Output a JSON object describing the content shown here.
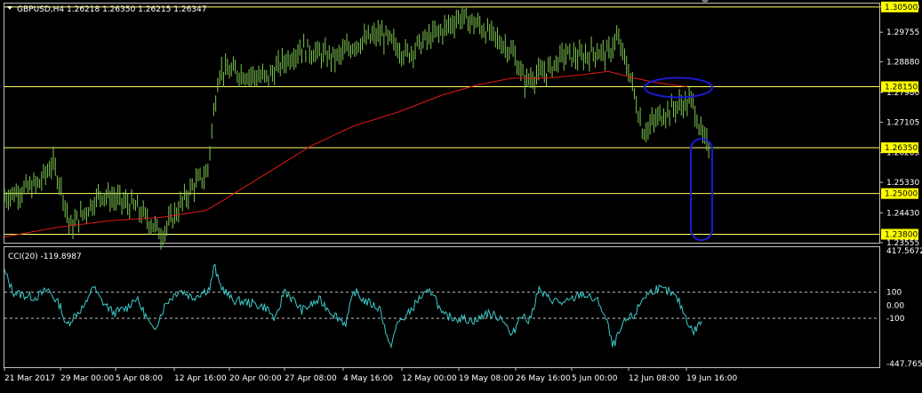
{
  "header": {
    "menu_icon": "triangle-down-icon",
    "title": "GBPUSD,H4  1.26218 1.26350 1.26215 1.26347"
  },
  "colors": {
    "background": "#000000",
    "frame": "#c0c0c0",
    "candles": "#7ec850",
    "moving_average": "#e01818",
    "level_line": "#ffff66",
    "level_label_bg": "#ffff00",
    "cci_line": "#3cc8c8",
    "annotation": "#1a1ad0",
    "text": "#ffffff"
  },
  "chart_data": [
    {
      "type": "line",
      "title": "GBPUSD,H4  1.26218 1.26350 1.26215 1.26347",
      "ylim": [
        1.2355,
        1.306
      ],
      "price_ticks": [
        "1.30500",
        "1.29755",
        "1.28880",
        "1.27980",
        "1.27105",
        "1.26205",
        "1.25330",
        "1.24430",
        "1.23555"
      ],
      "horizontal_levels": [
        "1.30500",
        "1.28150",
        "1.26350",
        "1.25000",
        "1.23800"
      ],
      "x_tick_labels": [
        "21 Mar 2017",
        "29 Mar 00:00",
        "5 Apr 08:00",
        "12 Apr 16:00",
        "20 Apr 00:00",
        "27 Apr 08:00",
        "4 May 16:00",
        "12 May 00:00",
        "19 May 08:00",
        "26 May 16:00",
        "5 Jun 00:00",
        "12 Jun 08:00",
        "19 Jun 16:00"
      ],
      "series": [
        {
          "kind": "price",
          "x": [
            0,
            0.02,
            0.04,
            0.055,
            0.065,
            0.075,
            0.09,
            0.11,
            0.13,
            0.15,
            0.165,
            0.18,
            0.195,
            0.215,
            0.232,
            0.238,
            0.245,
            0.26,
            0.28,
            0.3,
            0.32,
            0.34,
            0.36,
            0.38,
            0.4,
            0.43,
            0.46,
            0.48,
            0.5,
            0.52,
            0.54,
            0.56,
            0.58,
            0.595,
            0.6,
            0.62,
            0.64,
            0.66,
            0.675,
            0.69,
            0.7,
            0.715,
            0.73,
            0.75,
            0.77,
            0.787,
            0.797,
            0.805
          ],
          "y": [
            1.249,
            1.251,
            1.253,
            1.259,
            1.252,
            1.24,
            1.244,
            1.25,
            1.248,
            1.246,
            1.242,
            1.238,
            1.244,
            1.252,
            1.256,
            1.271,
            1.286,
            1.286,
            1.285,
            1.284,
            1.289,
            1.293,
            1.291,
            1.29,
            1.294,
            1.297,
            1.291,
            1.295,
            1.298,
            1.302,
            1.3,
            1.296,
            1.292,
            1.283,
            1.284,
            1.286,
            1.291,
            1.29,
            1.292,
            1.291,
            1.296,
            1.285,
            1.268,
            1.273,
            1.276,
            1.277,
            1.267,
            1.2635
          ]
        },
        {
          "kind": "moving_average",
          "x": [
            0,
            0.06,
            0.12,
            0.18,
            0.23,
            0.25,
            0.3,
            0.35,
            0.4,
            0.45,
            0.5,
            0.54,
            0.58,
            0.62,
            0.66,
            0.69,
            0.72,
            0.75,
            0.78
          ],
          "y": [
            1.2372,
            1.24,
            1.242,
            1.243,
            1.245,
            1.248,
            1.256,
            1.264,
            1.27,
            1.274,
            1.279,
            1.282,
            1.284,
            1.284,
            1.285,
            1.286,
            1.284,
            1.2825,
            1.2815
          ]
        }
      ],
      "annotations": [
        "blue ellipse around retest of 1.28150",
        "blue ellipse marking drop below 1.26350 toward 1.23800"
      ]
    },
    {
      "type": "line",
      "title": "CCI(20) -119.8987",
      "ylim": [
        -447.7658,
        417.5672
      ],
      "tick_labels": [
        "417.5672",
        "100",
        "0.00",
        "-100",
        "-447.7658"
      ],
      "reference_levels": [
        100,
        -100
      ],
      "series": [
        {
          "name": "CCI(20)",
          "x": [
            0,
            0.01,
            0.02,
            0.035,
            0.05,
            0.065,
            0.07,
            0.08,
            0.095,
            0.1,
            0.11,
            0.125,
            0.14,
            0.15,
            0.16,
            0.17,
            0.185,
            0.2,
            0.215,
            0.235,
            0.24,
            0.245,
            0.26,
            0.28,
            0.3,
            0.31,
            0.32,
            0.34,
            0.36,
            0.375,
            0.39,
            0.4,
            0.41,
            0.43,
            0.44,
            0.45,
            0.46,
            0.475,
            0.49,
            0.5,
            0.52,
            0.54,
            0.55,
            0.57,
            0.58,
            0.59,
            0.6,
            0.61,
            0.62,
            0.64,
            0.66,
            0.68,
            0.69,
            0.695,
            0.71,
            0.72,
            0.73,
            0.745,
            0.76,
            0.77,
            0.78,
            0.787,
            0.797
          ],
          "y": [
            260,
            100,
            80,
            60,
            120,
            -20,
            -160,
            -80,
            20,
            160,
            40,
            -60,
            -20,
            60,
            -60,
            -200,
            20,
            120,
            60,
            130,
            310,
            170,
            40,
            20,
            -20,
            -120,
            120,
            -40,
            40,
            -60,
            -140,
            110,
            40,
            -30,
            -330,
            -130,
            -80,
            60,
            110,
            -80,
            -100,
            -120,
            -60,
            -100,
            -250,
            -60,
            -130,
            120,
            60,
            10,
            90,
            20,
            -160,
            -320,
            -120,
            -80,
            60,
            130,
            100,
            40,
            -110,
            -210,
            -119.9
          ]
        }
      ]
    }
  ]
}
